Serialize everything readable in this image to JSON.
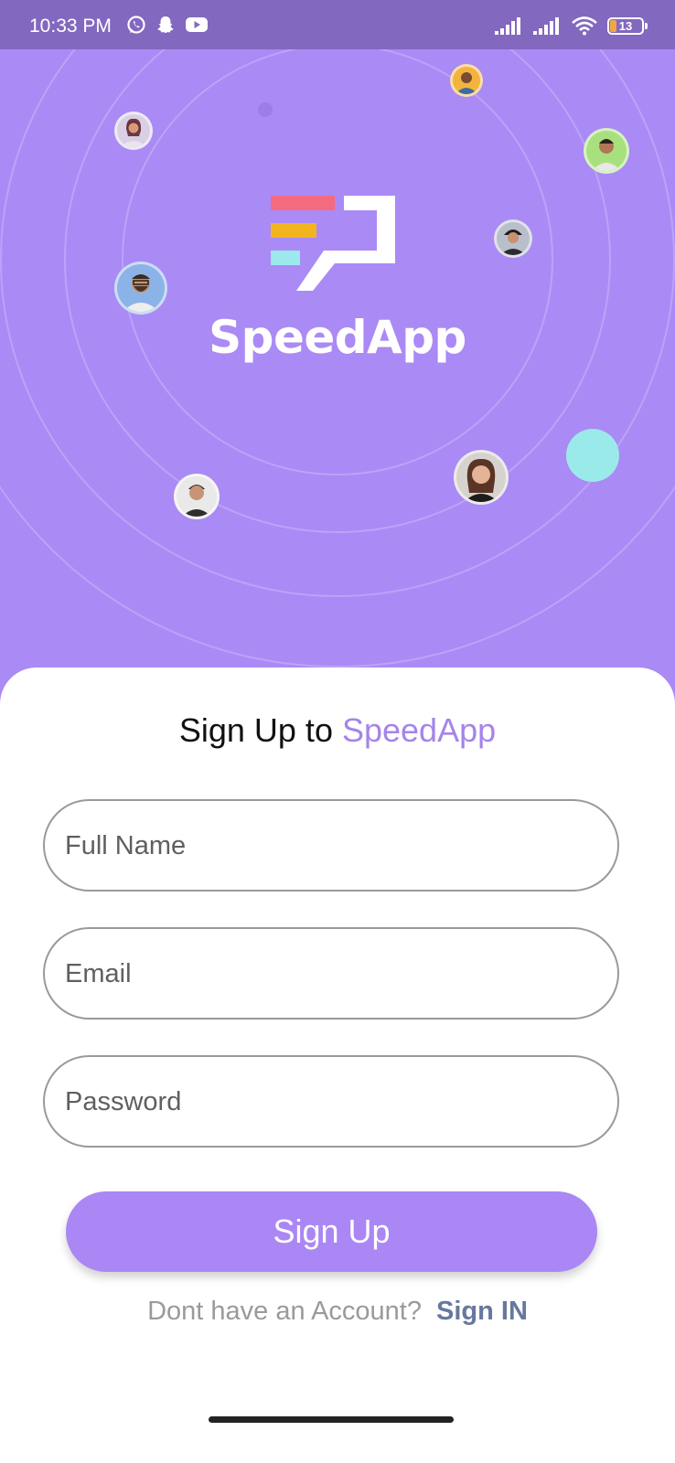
{
  "status_bar": {
    "time": "10:33 PM",
    "app_icons": [
      "whatsapp-icon",
      "snapchat-icon",
      "youtube-icon"
    ],
    "system_icons": [
      "signal-icon",
      "signal-icon",
      "wifi-icon"
    ],
    "battery": "13"
  },
  "hero": {
    "brand": "SpeedApp",
    "background_color": "#aa8af5",
    "logo_bar_colors": [
      "#f46b7f",
      "#f2b51e",
      "#9be9ec"
    ]
  },
  "form": {
    "title_prefix": "Sign Up to",
    "title_accent": "SpeedApp",
    "full_name_placeholder": "Full Name",
    "email_placeholder": "Email",
    "password_placeholder": "Password",
    "submit_label": "Sign Up",
    "footer_prompt": "Dont have an Account?",
    "footer_link": "Sign IN"
  },
  "colors": {
    "accent": "#a584ea",
    "button": "#aa87f4",
    "link": "#67789f"
  }
}
